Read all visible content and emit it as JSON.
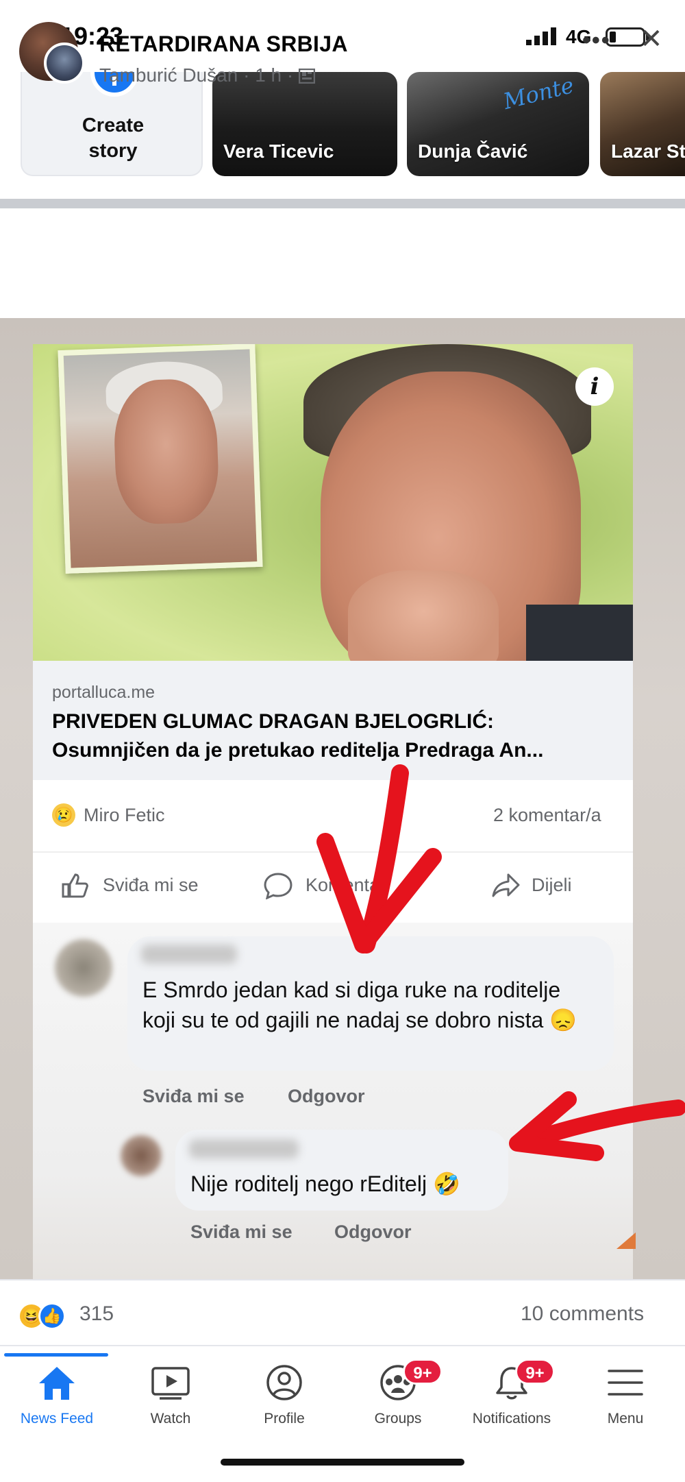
{
  "status_bar": {
    "time": "19:23",
    "network": "4G"
  },
  "stories": {
    "create_label": "Create story",
    "items": [
      {
        "name": "Vera Ticevic"
      },
      {
        "name": "Dunja Čavić",
        "logo_text": "Monte"
      },
      {
        "name": "Lazar St"
      }
    ]
  },
  "post": {
    "group_name": "RETARDIRANA SRBIJA",
    "author": "Tamburić Dušan",
    "time": "1 h",
    "more_label": "•••",
    "close_label": "✕"
  },
  "shared": {
    "info_label": "i",
    "link_domain": "portalluca.me",
    "link_title_line1": "PRIVEDEN GLUMAC DRAGAN BJELOGRLIĆ:",
    "link_title_line2": "Osumnjičen da je pretukao reditelja Predraga An...",
    "reactor": "Miro Fetic",
    "comment_count": "2 komentar/a",
    "actions": {
      "like": "Sviđa mi se",
      "comment": "Komentar",
      "share": "Dijeli"
    },
    "comments": [
      {
        "text": "E Smrdo jedan kad si diga ruke na roditelje koji su te od gajili ne nadaj se dobro nista 😞",
        "like_label": "Sviđa mi se",
        "reply_label": "Odgovor"
      },
      {
        "text": "Nije roditelj nego rEditelj 🤣",
        "like_label": "Sviđa mi se",
        "reply_label": "Odgovor"
      }
    ]
  },
  "footer": {
    "reaction_count": "315",
    "comments_count": "10 comments"
  },
  "nav": {
    "items": [
      {
        "label": "News Feed",
        "active": true
      },
      {
        "label": "Watch"
      },
      {
        "label": "Profile"
      },
      {
        "label": "Groups",
        "badge": "9+"
      },
      {
        "label": "Notifications",
        "badge": "9+"
      },
      {
        "label": "Menu"
      }
    ]
  },
  "colors": {
    "accent": "#1877f2",
    "badge": "#e41e3f",
    "annotation_arrow": "#e5131d"
  }
}
